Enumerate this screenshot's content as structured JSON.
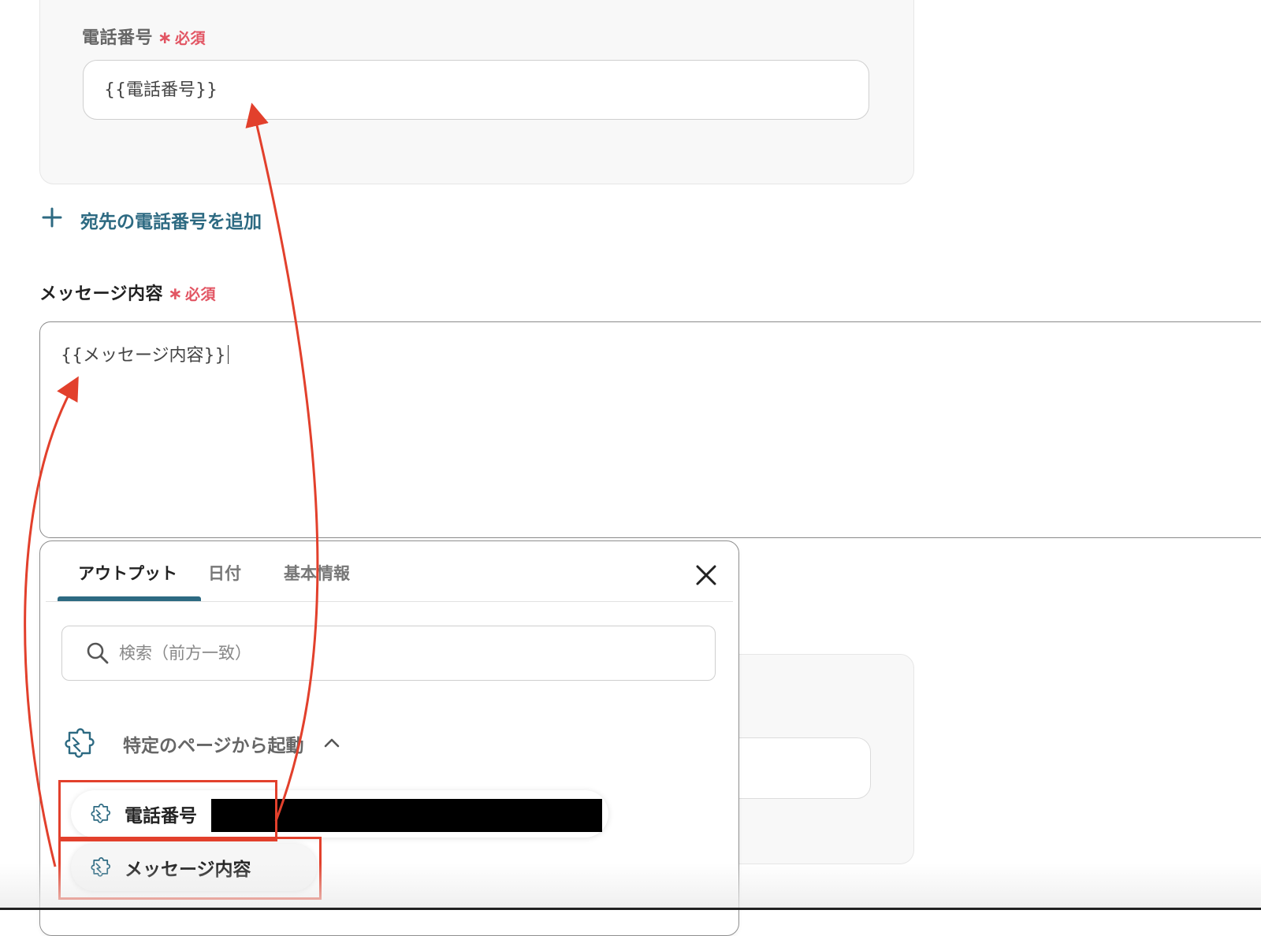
{
  "phone": {
    "label": "電話番号",
    "required_star": "∗",
    "required_text": "必須",
    "value": "{{電話番号}}"
  },
  "add_recipient": {
    "label": "宛先の電話番号を追加"
  },
  "message": {
    "label": "メッセージ内容",
    "required_star": "∗",
    "required_text": "必須",
    "value": "{{メッセージ内容}}"
  },
  "popup": {
    "tabs": [
      {
        "label": "アウトプット",
        "active": true
      },
      {
        "label": "日付",
        "active": false
      },
      {
        "label": "基本情報",
        "active": false
      }
    ],
    "search_placeholder": "検索（前方一致）",
    "group": {
      "label": "特定のページから起動",
      "expanded": true
    },
    "items": [
      {
        "label": "電話番号",
        "value_redacted": true
      },
      {
        "label": "メッセージ内容"
      }
    ]
  },
  "icons": {
    "add": "plus-icon",
    "close": "close-icon",
    "search": "search-icon",
    "group": "puzzle-icon",
    "chevron": "chevron-up-icon"
  },
  "colors": {
    "accent": "#2d6a82",
    "required": "#e25563",
    "annotation": "#e2402c"
  }
}
